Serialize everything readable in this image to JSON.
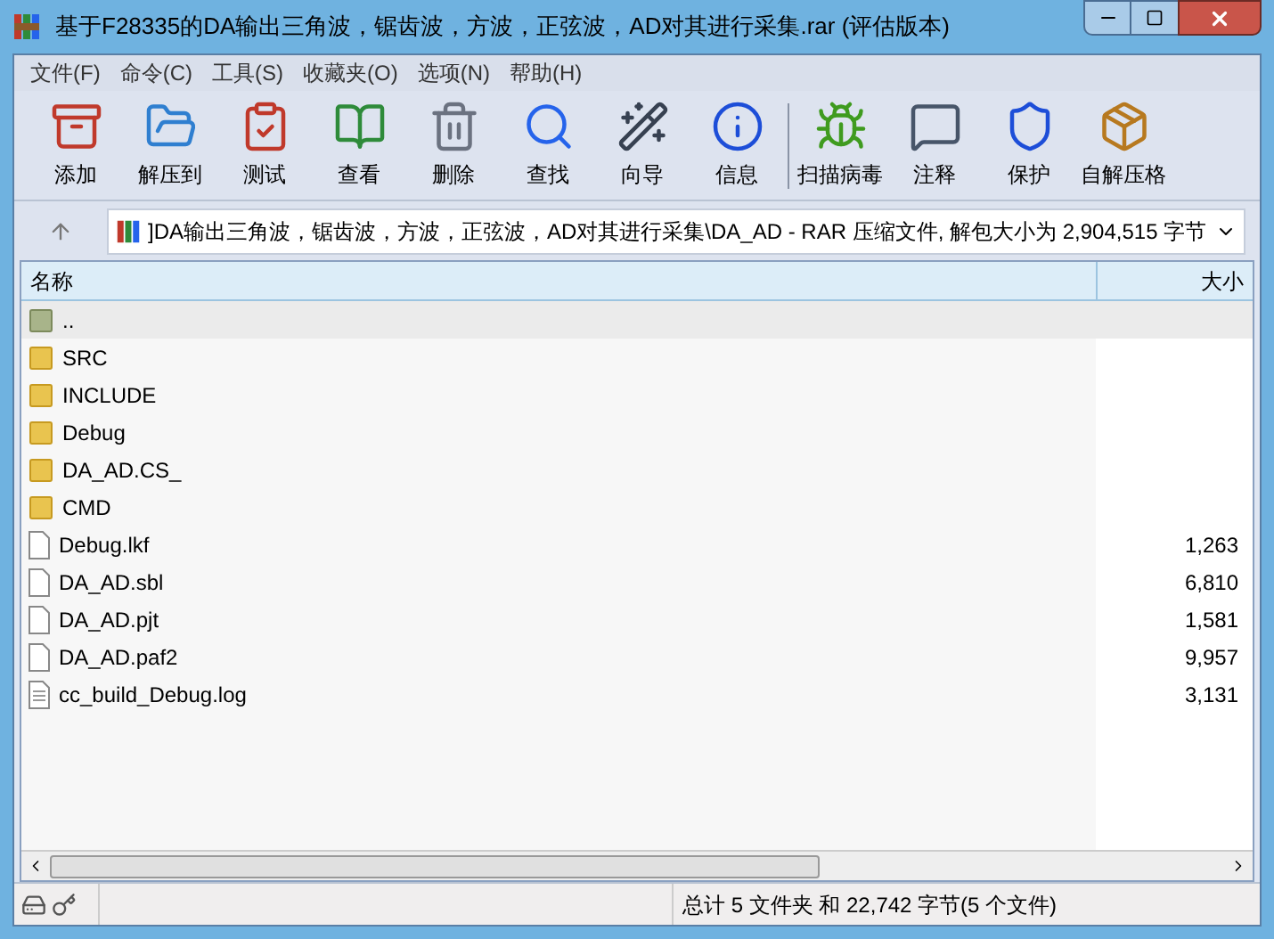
{
  "window": {
    "title": "基于F28335的DA输出三角波，锯齿波，方波，正弦波，AD对其进行采集.rar (评估版本)"
  },
  "menu": [
    "文件(F)",
    "命令(C)",
    "工具(S)",
    "收藏夹(O)",
    "选项(N)",
    "帮助(H)"
  ],
  "toolbar": [
    {
      "kind": "add",
      "label": "添加"
    },
    {
      "kind": "extract",
      "label": "解压到"
    },
    {
      "kind": "test",
      "label": "测试"
    },
    {
      "kind": "view",
      "label": "查看"
    },
    {
      "kind": "delete",
      "label": "删除"
    },
    {
      "kind": "find",
      "label": "查找"
    },
    {
      "kind": "wizard",
      "label": "向导"
    },
    {
      "kind": "info",
      "label": "信息"
    },
    {
      "kind": "virus",
      "label": "扫描病毒"
    },
    {
      "kind": "comment",
      "label": "注释"
    },
    {
      "kind": "protect",
      "label": "保护"
    },
    {
      "kind": "sfx",
      "label": "自解压格"
    }
  ],
  "address": {
    "value": "]DA输出三角波，锯齿波，方波，正弦波，AD对其进行采集\\DA_AD - RAR 压缩文件, 解包大小为 2,904,515 字节"
  },
  "table": {
    "columns": [
      "名称",
      "大小"
    ],
    "rows": [
      {
        "kind": "up",
        "name": "..",
        "size": "",
        "selected": true
      },
      {
        "kind": "folder",
        "name": "SRC",
        "selected": false
      },
      {
        "kind": "folder",
        "name": "INCLUDE",
        "selected": false
      },
      {
        "kind": "folder",
        "name": "Debug",
        "selected": false
      },
      {
        "kind": "folder",
        "name": "DA_AD.CS_",
        "selected": false
      },
      {
        "kind": "folder",
        "name": "CMD",
        "selected": false
      },
      {
        "kind": "file",
        "name": "Debug.lkf",
        "size": "1,263",
        "selected": false
      },
      {
        "kind": "file",
        "name": "DA_AD.sbl",
        "size": "6,810",
        "selected": false
      },
      {
        "kind": "file",
        "name": "DA_AD.pjt",
        "size": "1,581",
        "selected": false
      },
      {
        "kind": "file",
        "name": "DA_AD.paf2",
        "size": "9,957",
        "selected": false
      },
      {
        "kind": "text",
        "name": "cc_build_Debug.log",
        "size": "3,131",
        "selected": false
      }
    ]
  },
  "status_bar": {
    "summary": "总计 5 文件夹 和 22,742 字节(5 个文件)"
  }
}
